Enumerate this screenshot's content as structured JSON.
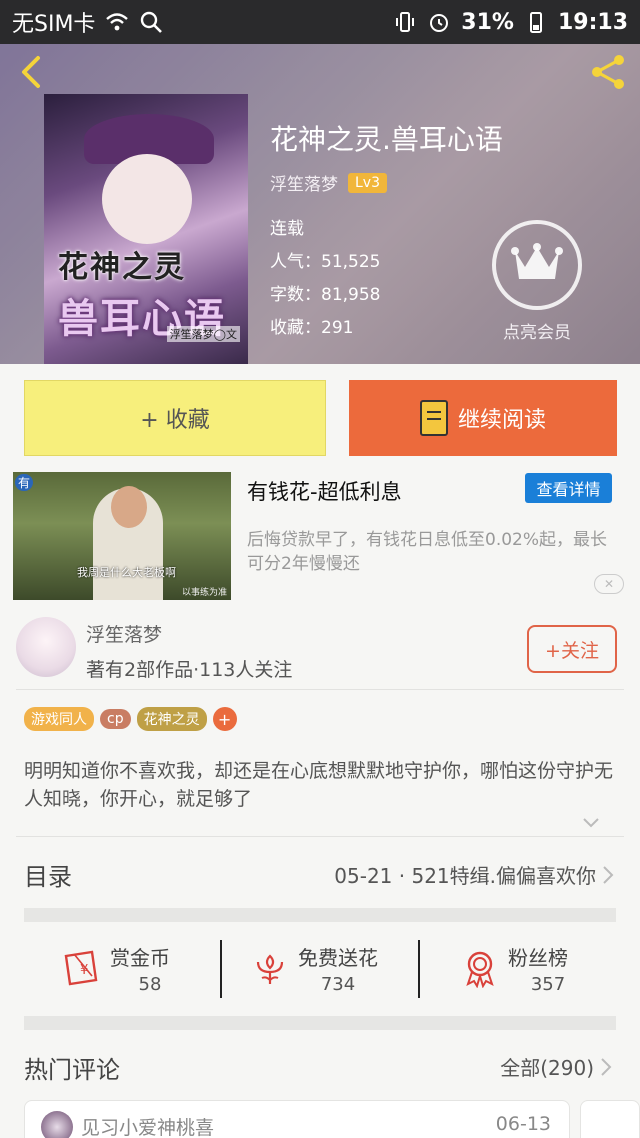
{
  "status_bar": {
    "carrier": "无SIM卡",
    "battery": "31%",
    "time": "19:13"
  },
  "book": {
    "title": "花神之灵.兽耳心语",
    "author": "浮笙落梦",
    "level": "Lv3",
    "status": "连载",
    "popularity": "人气：51,525",
    "words": "字数：81,958",
    "favorites": "收藏：291",
    "vip_label": "点亮会员",
    "cover": {
      "title_line1": "花神之灵",
      "title_line2": "兽耳心语",
      "credit": "浮笙落梦◯文"
    }
  },
  "actions": {
    "collect": "+ 收藏",
    "read": "继续阅读"
  },
  "ad": {
    "badge": "有",
    "title": "有钱花-超低利息",
    "detail_button": "查看详情",
    "description": "后悔贷款早了，有钱花日息低至0.02%起，最长可分2年慢慢还",
    "caption": "我周是什么大老板啊",
    "caption_small": "以事练为准",
    "close": "✕"
  },
  "author_card": {
    "name": "浮笙落梦",
    "stats": "著有2部作品·113人关注",
    "follow": "+关注"
  },
  "tags": [
    "游戏同人",
    "cp",
    "花神之灵"
  ],
  "tag_add": "+",
  "summary": "明明知道你不喜欢我，却还是在心底想默默地守护你，哪怕这份守护无人知晓，你开心，就足够了",
  "toc": {
    "label": "目录",
    "latest": "05-21 · 521特缉.偏偏喜欢你"
  },
  "stats": [
    {
      "label": "赏金币",
      "value": "58",
      "icon": "red-envelope-icon"
    },
    {
      "label": "免费送花",
      "value": "734",
      "icon": "flower-icon"
    },
    {
      "label": "粉丝榜",
      "value": "357",
      "icon": "medal-icon"
    }
  ],
  "comments": {
    "label": "热门评论",
    "all": "全部(290)",
    "first": {
      "user": "见习小爱神桃喜",
      "date": "06-13"
    }
  },
  "colors": {
    "accent_orange": "#ec6a3c",
    "collect_yellow": "#f7ef7c",
    "link_blue": "#1a7fd8",
    "level_gold": "#f1b63a"
  }
}
